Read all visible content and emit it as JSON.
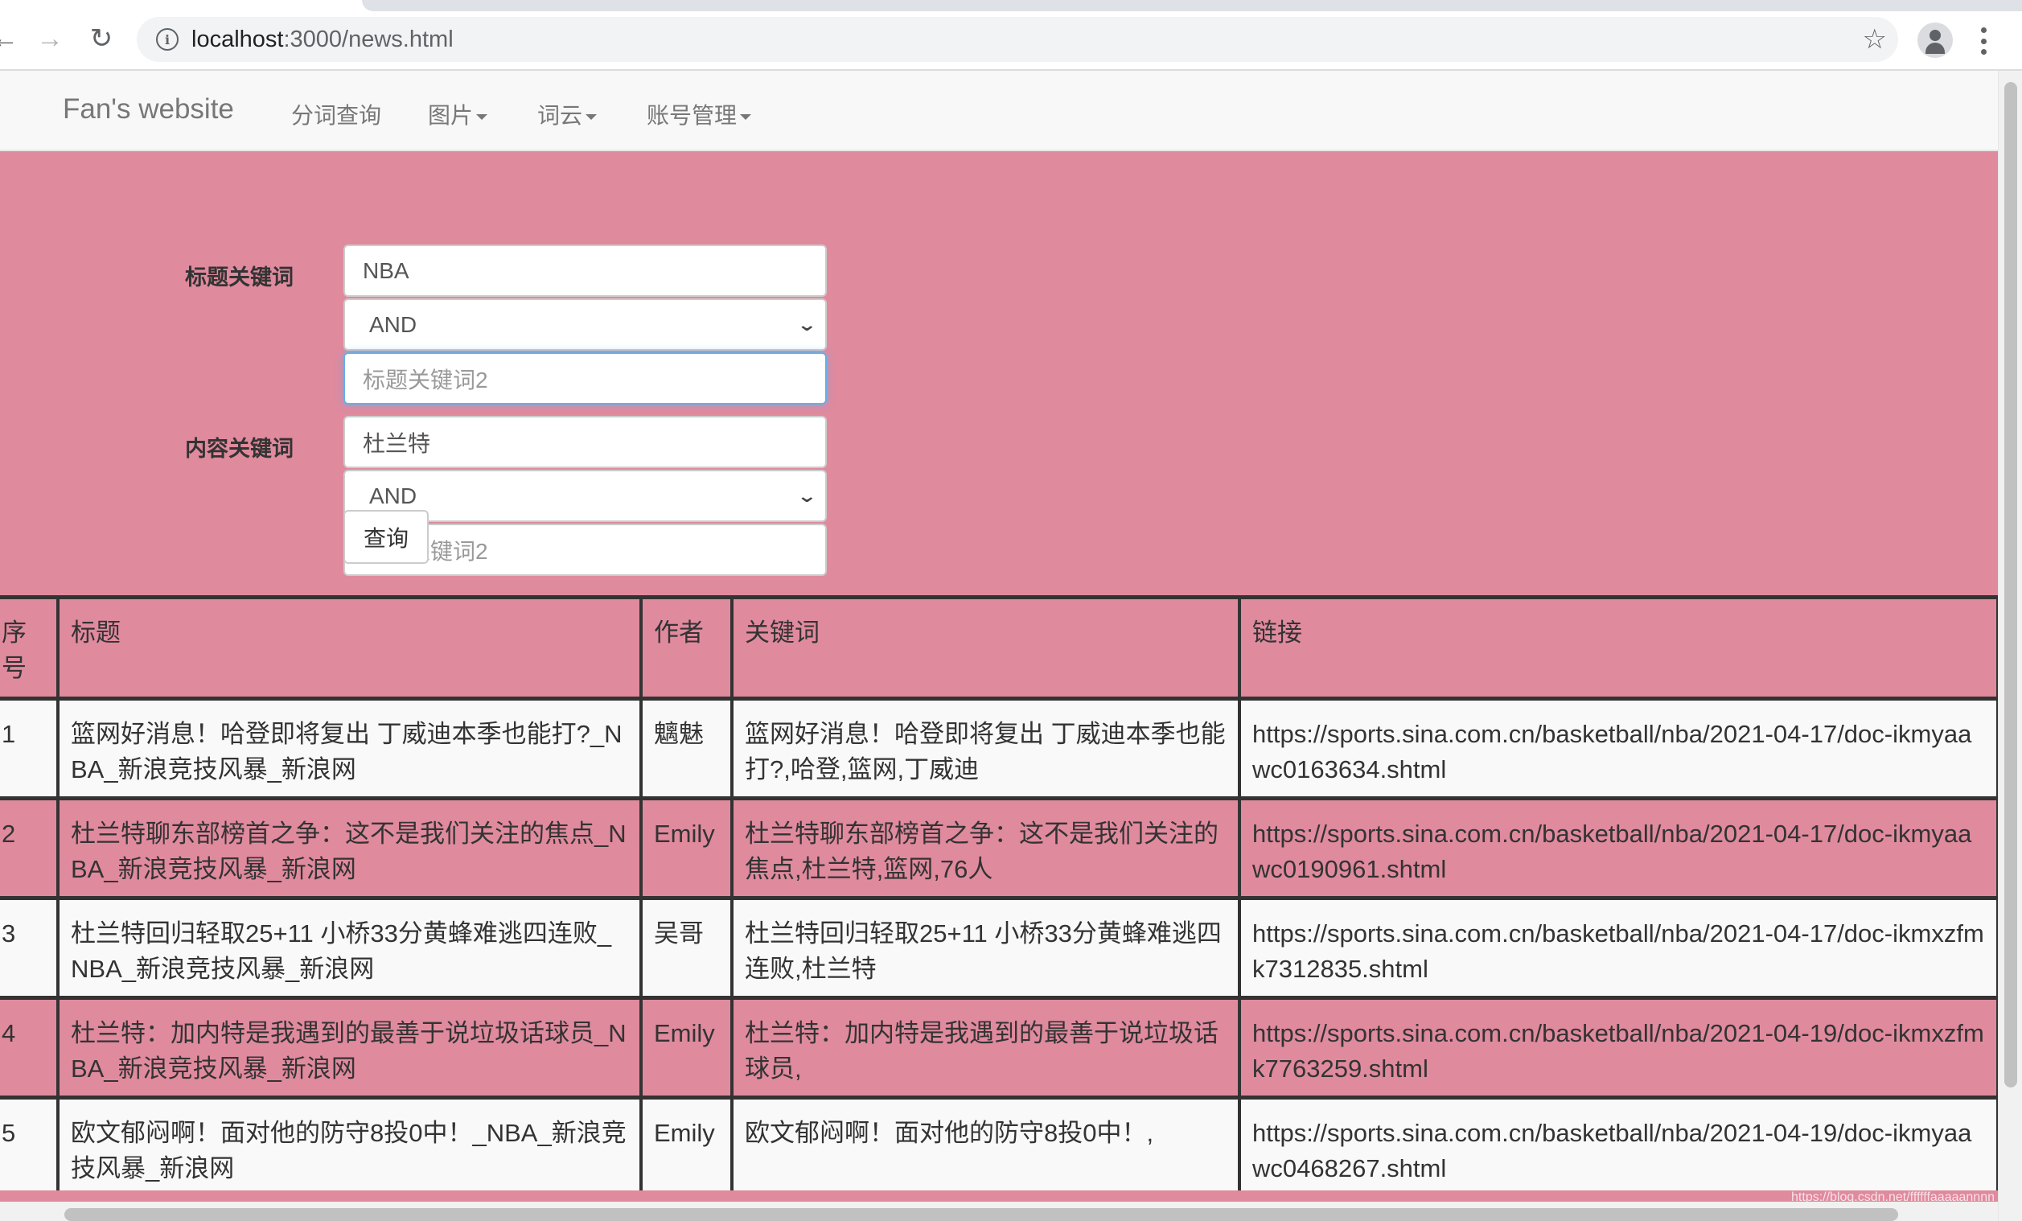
{
  "browser": {
    "url_host": "localhost",
    "url_path": ":3000/news.html"
  },
  "navbar": {
    "brand": "Fan's website",
    "items": [
      {
        "label": "分词查询",
        "dropdown": false
      },
      {
        "label": "图片",
        "dropdown": true
      },
      {
        "label": "词云",
        "dropdown": true
      },
      {
        "label": "账号管理",
        "dropdown": true
      }
    ]
  },
  "form": {
    "title_label": "标题关键词",
    "title_keyword1": "NBA",
    "title_operator": "AND",
    "title_keyword2_placeholder": "标题关键词2",
    "content_label": "内容关键词",
    "content_keyword1": "杜兰特",
    "content_operator": "AND",
    "content_keyword2_placeholder": "内容关键词2",
    "submit_label": "查询"
  },
  "table": {
    "headers": [
      "序号",
      "标题",
      "作者",
      "关键词",
      "链接"
    ],
    "rows": [
      {
        "index": "1",
        "title": "篮网好消息！哈登即将复出 丁威迪本季也能打?_NBA_新浪竞技风暴_新浪网",
        "author": "魑魅",
        "keywords": "篮网好消息！哈登即将复出 丁威迪本季也能打?,哈登,篮网,丁威迪",
        "link": "https://sports.sina.com.cn/basketball/nba/2021-04-17/doc-ikmyaawc0163634.shtml"
      },
      {
        "index": "2",
        "title": "杜兰特聊东部榜首之争：这不是我们关注的焦点_NBA_新浪竞技风暴_新浪网",
        "author": "Emily",
        "keywords": "杜兰特聊东部榜首之争：这不是我们关注的焦点,杜兰特,篮网,76人",
        "link": "https://sports.sina.com.cn/basketball/nba/2021-04-17/doc-ikmyaawc0190961.shtml"
      },
      {
        "index": "3",
        "title": "杜兰特回归轻取25+11 小桥33分黄蜂难逃四连败_NBA_新浪竞技风暴_新浪网",
        "author": "吴哥",
        "keywords": "杜兰特回归轻取25+11 小桥33分黄蜂难逃四连败,杜兰特",
        "link": "https://sports.sina.com.cn/basketball/nba/2021-04-17/doc-ikmxzfmk7312835.shtml"
      },
      {
        "index": "4",
        "title": "杜兰特：加内特是我遇到的最善于说垃圾话球员_NBA_新浪竞技风暴_新浪网",
        "author": "Emily",
        "keywords": "杜兰特：加内特是我遇到的最善于说垃圾话球员,",
        "link": "https://sports.sina.com.cn/basketball/nba/2021-04-19/doc-ikmxzfmk7763259.shtml"
      },
      {
        "index": "5",
        "title": "欧文郁闷啊！面对他的防守8投0中！_NBA_新浪竞技风暴_新浪网",
        "author": "Emily",
        "keywords": "欧文郁闷啊！面对他的防守8投0中！,",
        "link": "https://sports.sina.com.cn/basketball/nba/2021-04-19/doc-ikmyaawc0468267.shtml"
      }
    ]
  },
  "watermark": "https://blog.csdn.net/ffffffaaaaannnn",
  "colors": {
    "accent_pink": "#e08a9e",
    "navbar_bg": "#f8f8f8",
    "table_border": "#333333"
  }
}
